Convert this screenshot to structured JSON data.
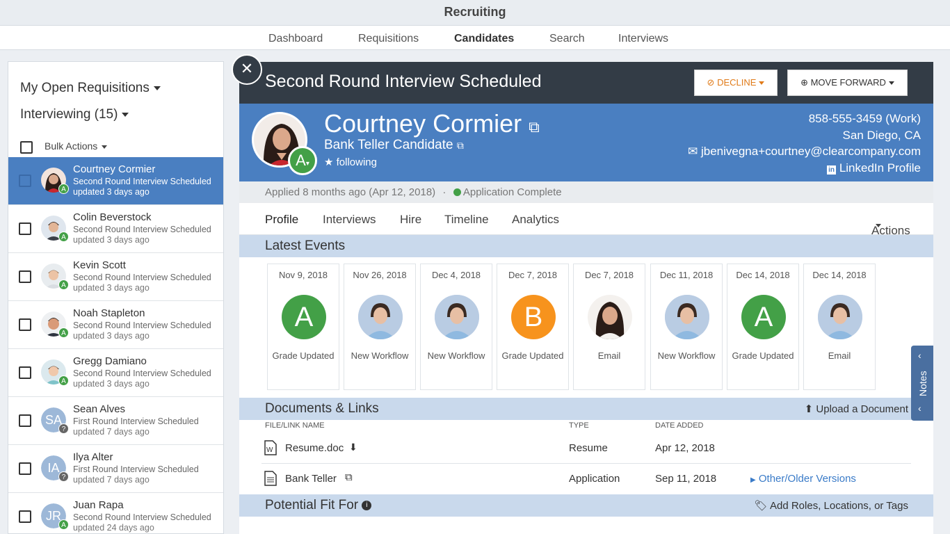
{
  "app": {
    "title": "Recruiting"
  },
  "nav": {
    "items": [
      {
        "label": "Dashboard"
      },
      {
        "label": "Requisitions"
      },
      {
        "label": "Candidates"
      },
      {
        "label": "Search"
      },
      {
        "label": "Interviews"
      }
    ]
  },
  "sidebar": {
    "requisitions_label": "My Open Requisitions",
    "filter_label": "Interviewing (15)",
    "bulk_label": "Bulk Actions",
    "candidates": [
      {
        "name": "Courtney Cormier",
        "status": "Second Round Interview Scheduled",
        "updated": "updated 3 days ago",
        "badge": "A"
      },
      {
        "name": "Colin Beverstock",
        "status": "Second Round Interview Scheduled",
        "updated": "updated 3 days ago",
        "badge": "A"
      },
      {
        "name": "Kevin Scott",
        "status": "Second Round Interview Scheduled",
        "updated": "updated 3 days ago",
        "badge": "A"
      },
      {
        "name": "Noah Stapleton",
        "status": "Second Round Interview Scheduled",
        "updated": "updated 3 days ago",
        "badge": "A"
      },
      {
        "name": "Gregg Damiano",
        "status": "Second Round Interview Scheduled",
        "updated": "updated 3 days ago",
        "badge": "A"
      },
      {
        "name": "Sean Alves",
        "initials": "SA",
        "status": "First Round Interview Scheduled",
        "updated": "updated 7 days ago",
        "badge": "?"
      },
      {
        "name": "Ilya Alter",
        "initials": "IA",
        "status": "First Round Interview Scheduled",
        "updated": "updated 7 days ago",
        "badge": "?"
      },
      {
        "name": "Juan Rapa",
        "initials": "JR",
        "status": "Second Round Interview Scheduled",
        "updated": "updated 24 days ago",
        "badge": "A"
      }
    ]
  },
  "detail": {
    "stage_title": "Second Round Interview Scheduled",
    "decline_label": "DECLINE",
    "move_label": "MOVE FORWARD",
    "candidate_name": "Courtney Cormier",
    "candidate_role": "Bank Teller Candidate",
    "following_label": "following",
    "grade": "A",
    "phone": "858-555-3459 (Work)",
    "location": "San Diego, CA",
    "email": "jbenivegna+courtney@clearcompany.com",
    "linkedin": "LinkedIn Profile",
    "applied": "Applied 8 months ago (Apr 12, 2018)",
    "separator": "·",
    "application_status": "Application Complete",
    "tabs": [
      "Profile",
      "Interviews",
      "Hire",
      "Timeline",
      "Analytics"
    ],
    "actions_label": "Actions"
  },
  "events": {
    "title": "Latest Events",
    "items": [
      {
        "date": "Nov 9, 2018",
        "label": "Grade Updated",
        "grade": "A",
        "color": "#43a047"
      },
      {
        "date": "Nov 26, 2018",
        "label": "New Workflow"
      },
      {
        "date": "Dec 4, 2018",
        "label": "New Workflow"
      },
      {
        "date": "Dec 7, 2018",
        "label": "Grade Updated",
        "grade": "B",
        "color": "#f7931d"
      },
      {
        "date": "Dec 7, 2018",
        "label": "Email"
      },
      {
        "date": "Dec 11, 2018",
        "label": "New Workflow"
      },
      {
        "date": "Dec 14, 2018",
        "label": "Grade Updated",
        "grade": "A",
        "color": "#43a047"
      },
      {
        "date": "Dec 14, 2018",
        "label": "Email"
      }
    ]
  },
  "documents": {
    "title": "Documents & Links",
    "upload_label": "Upload a Document",
    "col_name": "FILE/LINK NAME",
    "col_type": "TYPE",
    "col_date": "DATE ADDED",
    "rows": [
      {
        "name": "Resume.doc",
        "type": "Resume",
        "date": "Apr 12, 2018"
      },
      {
        "name": "Bank Teller",
        "type": "Application",
        "date": "Sep 11, 2018",
        "extra": "Other/Older Versions"
      }
    ]
  },
  "fit": {
    "title": "Potential Fit For",
    "add_label": "Add Roles, Locations, or Tags"
  },
  "notes": {
    "label": "Notes"
  }
}
